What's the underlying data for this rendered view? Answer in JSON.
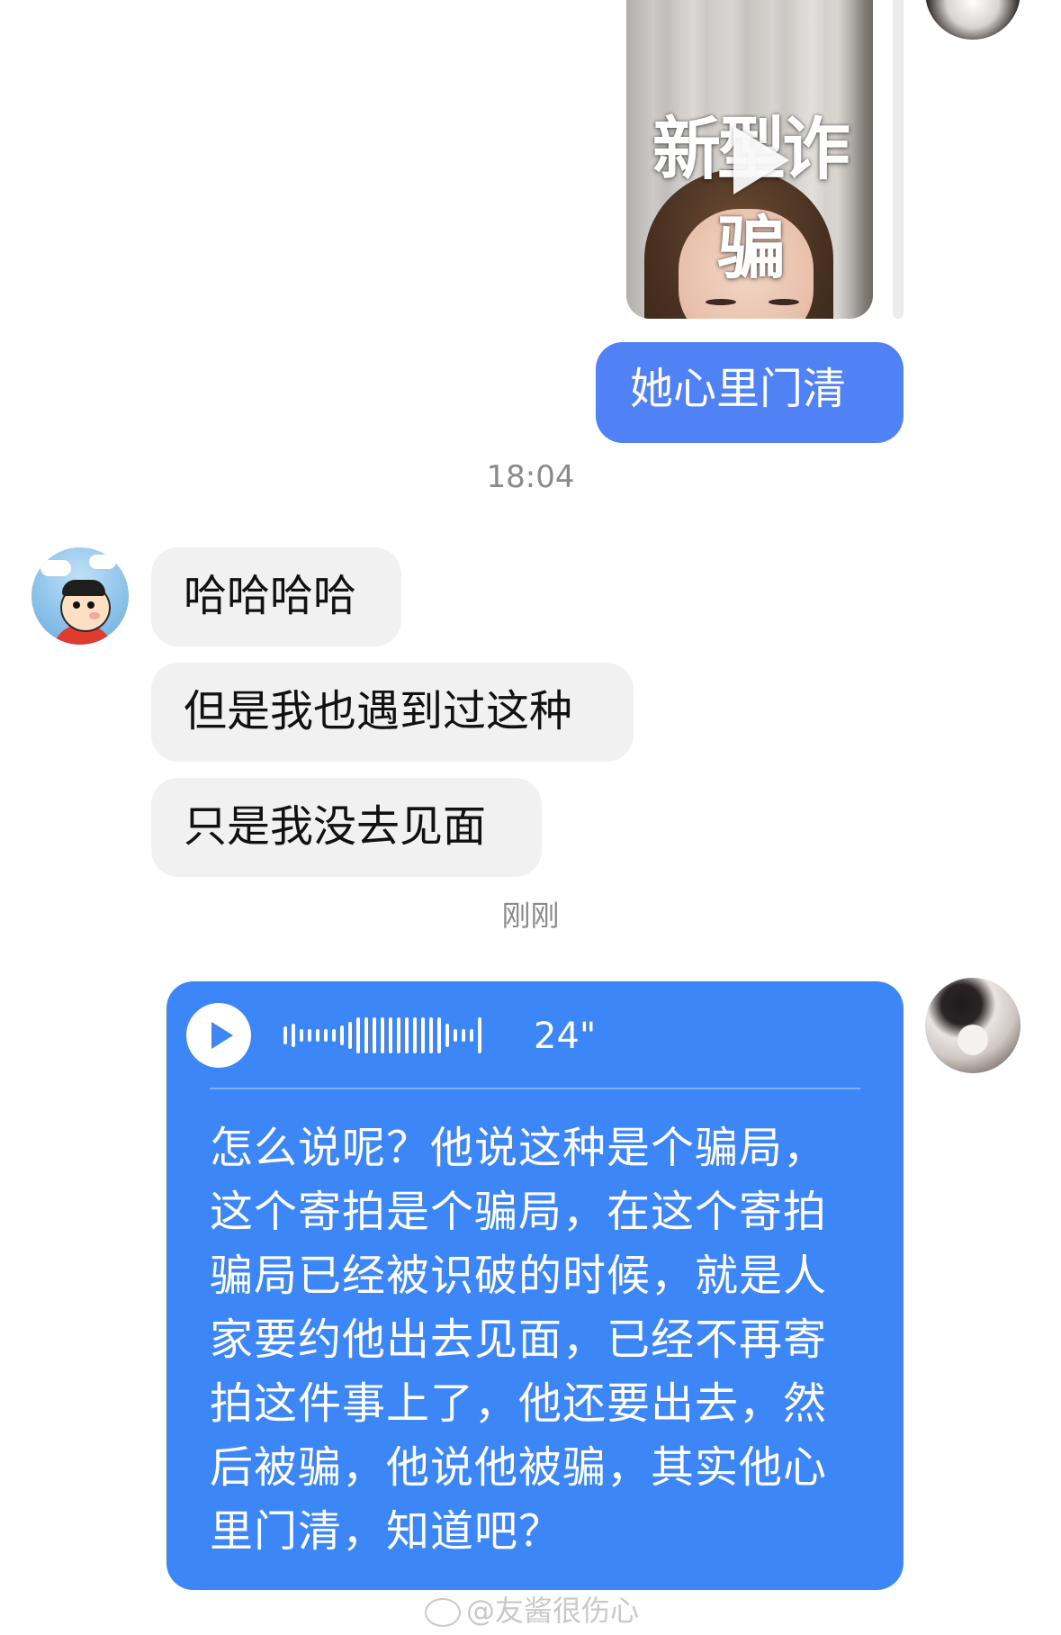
{
  "chat": {
    "video_message": {
      "overlay_text": "新型诈骗",
      "icon": "play-icon"
    },
    "messages_outgoing": [
      {
        "text": "她心里门清"
      }
    ],
    "timestamp_1": "18:04",
    "messages_incoming": [
      {
        "text": "哈哈哈哈"
      },
      {
        "text": "但是我也遇到过这种"
      },
      {
        "text": "只是我没去见面"
      }
    ],
    "timestamp_2": "刚刚",
    "voice_message": {
      "duration": "24\"",
      "transcript_lines": [
        "怎么说呢？他说这种是个骗局，",
        "这个寄拍是个骗局，在这个寄拍",
        "骗局已经被识破的时候，就是人",
        "家要约他出去见面，已经不再寄",
        "拍这件事上了，他还要出去，然",
        "后被骗，他说他被骗，其实他心",
        "里门清，知道吧？"
      ],
      "colors": {
        "bubble": "#3c86f8"
      }
    },
    "colors": {
      "outgoing_bubble": "#5082f6",
      "incoming_bubble": "#f1f1f1"
    }
  },
  "watermark": {
    "text": "@友酱很伤心",
    "icon": "weibo-icon"
  }
}
